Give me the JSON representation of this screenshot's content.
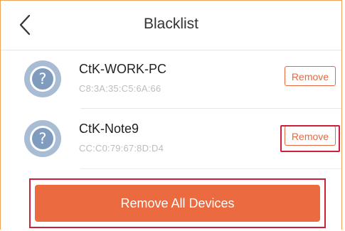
{
  "header": {
    "title": "Blacklist",
    "back_icon": "chevron-left-icon"
  },
  "devices": [
    {
      "name": "CtK-WORK-PC",
      "mac": "C8:3A:35:C5:6A:66",
      "avatar_glyph": "?",
      "remove_label": "Remove"
    },
    {
      "name": "CtK-Note9",
      "mac": "CC:C0:79:67:8D:D4",
      "avatar_glyph": "?",
      "remove_label": "Remove"
    }
  ],
  "footer": {
    "remove_all_label": "Remove All Devices"
  },
  "colors": {
    "accent": "#ec6a3f",
    "highlight": "#cc1f3a",
    "avatar": "#a8bcd4",
    "mac_text": "#bdbdbd"
  }
}
